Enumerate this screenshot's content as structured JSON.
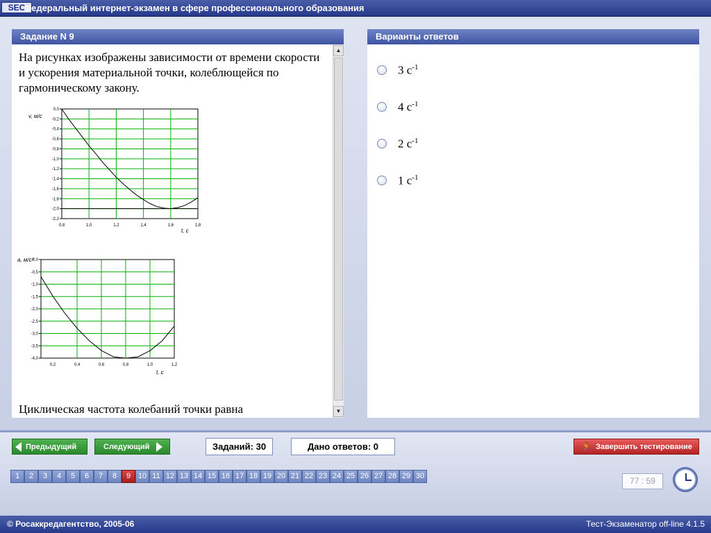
{
  "app": {
    "logo": "SEC",
    "title": "Федеральный интернет-экзамен в сфере профессионального образования"
  },
  "question": {
    "header": "Задание N 9",
    "text": "На рисунках изображены зависимости от времени скорости и ускорения материальной точки, колеблющейся по гармоническому закону.",
    "footer": "Циклическая частота колебаний точки равна"
  },
  "answers": {
    "header": "Варианты ответов",
    "options": [
      {
        "base": "3 с",
        "exp": "-1"
      },
      {
        "base": "4 с",
        "exp": "-1"
      },
      {
        "base": "2 с",
        "exp": "-1"
      },
      {
        "base": "1 с",
        "exp": "-1"
      }
    ]
  },
  "nav": {
    "prev": "Предыдущий",
    "next": "Следующий",
    "tasks": "Заданий: 30",
    "answered": "Дано ответов: 0",
    "finish": "Завершить тестирование",
    "numbers": [
      "1",
      "2",
      "3",
      "4",
      "5",
      "6",
      "7",
      "8",
      "9",
      "10",
      "11",
      "12",
      "13",
      "14",
      "15",
      "16",
      "17",
      "18",
      "19",
      "20",
      "21",
      "22",
      "23",
      "24",
      "25",
      "26",
      "27",
      "28",
      "29",
      "30"
    ],
    "current": "9",
    "timer": "77 : 59"
  },
  "status": {
    "copyright": "© Росаккредагентство, 2005-06",
    "version": "Тест-Экзаменатор off-line 4.1.5"
  },
  "colors": {
    "header_blue": "#3e54a1",
    "grid_green": "#00b000",
    "nav_green": "#2a8a2d",
    "finish_red": "#b42424"
  },
  "chart_data": [
    {
      "type": "line",
      "ylabel": "v, м/с",
      "xlabel": "t, с",
      "xlim": [
        0.8,
        1.8
      ],
      "ylim": [
        -2.2,
        0.0
      ],
      "xticks": [
        "0,8",
        "1,0",
        "1,2",
        "1,4",
        "1,6",
        "1,8"
      ],
      "yticks": [
        "0,0",
        "-0,2",
        "-0,4",
        "-0,6",
        "-0,8",
        "-1,0",
        "-1,2",
        "-1,4",
        "-1,6",
        "-1,8",
        "-2,0",
        "-2,2"
      ],
      "grid": true,
      "x": [
        0.8,
        0.85,
        0.9,
        0.95,
        1.0,
        1.05,
        1.1,
        1.15,
        1.2,
        1.25,
        1.3,
        1.35,
        1.4,
        1.45,
        1.5,
        1.55,
        1.6,
        1.65,
        1.7,
        1.75,
        1.8
      ],
      "y": [
        0.0,
        -0.2,
        -0.38,
        -0.56,
        -0.74,
        -0.9,
        -1.07,
        -1.22,
        -1.37,
        -1.5,
        -1.62,
        -1.73,
        -1.82,
        -1.9,
        -1.96,
        -1.99,
        -2.0,
        -1.98,
        -1.94,
        -1.87,
        -1.78
      ]
    },
    {
      "type": "line",
      "ylabel": "a, м/с²",
      "xlabel": "t, с",
      "xlim": [
        0.1,
        1.2
      ],
      "ylim": [
        -4.0,
        0.0
      ],
      "xticks": [
        "0,2",
        "0,4",
        "0,6",
        "0,8",
        "1,0",
        "1,2"
      ],
      "yticks": [
        "0,0",
        "-0,5",
        "-1,0",
        "-1,5",
        "-2,0",
        "-2,5",
        "-3,0",
        "-3,5",
        "-4,0"
      ],
      "grid": true,
      "x": [
        0.1,
        0.2,
        0.3,
        0.4,
        0.5,
        0.6,
        0.7,
        0.8,
        0.9,
        1.0,
        1.1,
        1.2
      ],
      "y": [
        -0.7,
        -1.5,
        -2.2,
        -2.8,
        -3.3,
        -3.7,
        -3.95,
        -4.0,
        -3.95,
        -3.7,
        -3.3,
        -2.7
      ]
    }
  ]
}
